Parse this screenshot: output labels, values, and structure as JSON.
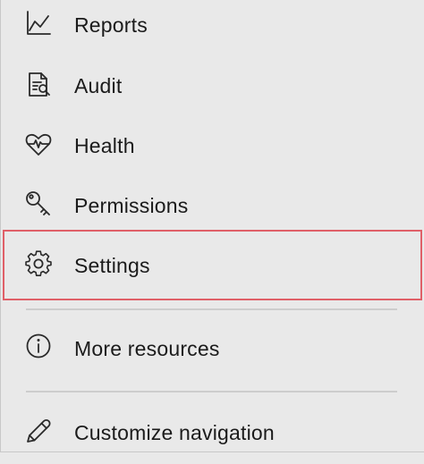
{
  "nav": {
    "items": [
      {
        "label": "Reports",
        "icon": "line-chart-icon"
      },
      {
        "label": "Audit",
        "icon": "document-search-icon"
      },
      {
        "label": "Health",
        "icon": "heartbeat-icon"
      },
      {
        "label": "Permissions",
        "icon": "key-icon"
      },
      {
        "label": "Settings",
        "icon": "gear-icon"
      },
      {
        "label": "More resources",
        "icon": "info-icon"
      },
      {
        "label": "Customize navigation",
        "icon": "pencil-icon"
      }
    ]
  },
  "colors": {
    "background": "#e9e9e9",
    "text": "#1b1b1b",
    "highlight_border": "#e06068",
    "divider": "#cdcdcd"
  }
}
